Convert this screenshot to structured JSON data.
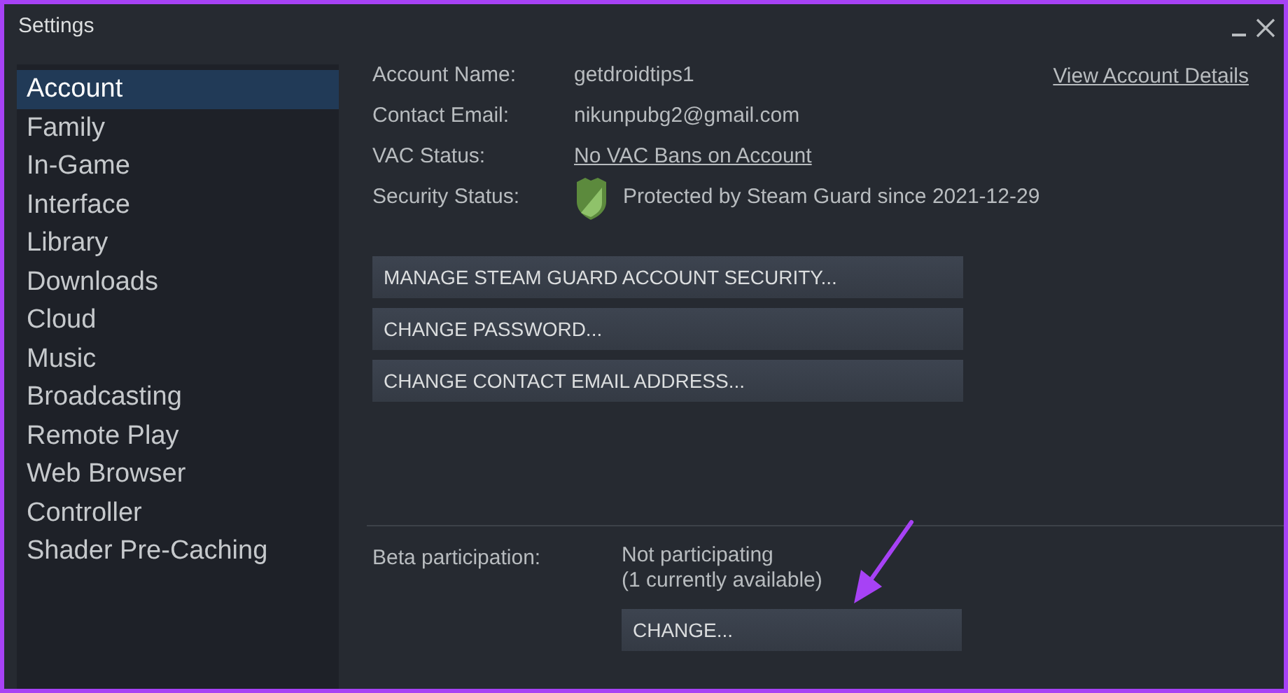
{
  "window": {
    "title": "Settings"
  },
  "sidebar": {
    "items": [
      {
        "label": "Account",
        "selected": true
      },
      {
        "label": "Family",
        "selected": false
      },
      {
        "label": "In-Game",
        "selected": false
      },
      {
        "label": "Interface",
        "selected": false
      },
      {
        "label": "Library",
        "selected": false
      },
      {
        "label": "Downloads",
        "selected": false
      },
      {
        "label": "Cloud",
        "selected": false
      },
      {
        "label": "Music",
        "selected": false
      },
      {
        "label": "Broadcasting",
        "selected": false
      },
      {
        "label": "Remote Play",
        "selected": false
      },
      {
        "label": "Web Browser",
        "selected": false
      },
      {
        "label": "Controller",
        "selected": false
      },
      {
        "label": "Shader Pre-Caching",
        "selected": false
      }
    ]
  },
  "account": {
    "fields": [
      {
        "label": "Account Name:",
        "value": "getdroidtips1",
        "kind": "text"
      },
      {
        "label": "Contact Email:",
        "value": "nikunpubg2@gmail.com",
        "kind": "text"
      },
      {
        "label": "VAC Status:",
        "value": "No VAC Bans on Account",
        "kind": "link"
      },
      {
        "label": "Security Status:",
        "value": "Protected by Steam Guard since 2021-12-29",
        "kind": "shield"
      }
    ],
    "details_link": "View Account Details",
    "buttons": [
      "MANAGE STEAM GUARD ACCOUNT SECURITY...",
      "CHANGE PASSWORD...",
      "CHANGE CONTACT EMAIL ADDRESS..."
    ]
  },
  "beta": {
    "label": "Beta participation:",
    "status": "Not participating",
    "note": "(1 currently available)",
    "button": "CHANGE..."
  }
}
